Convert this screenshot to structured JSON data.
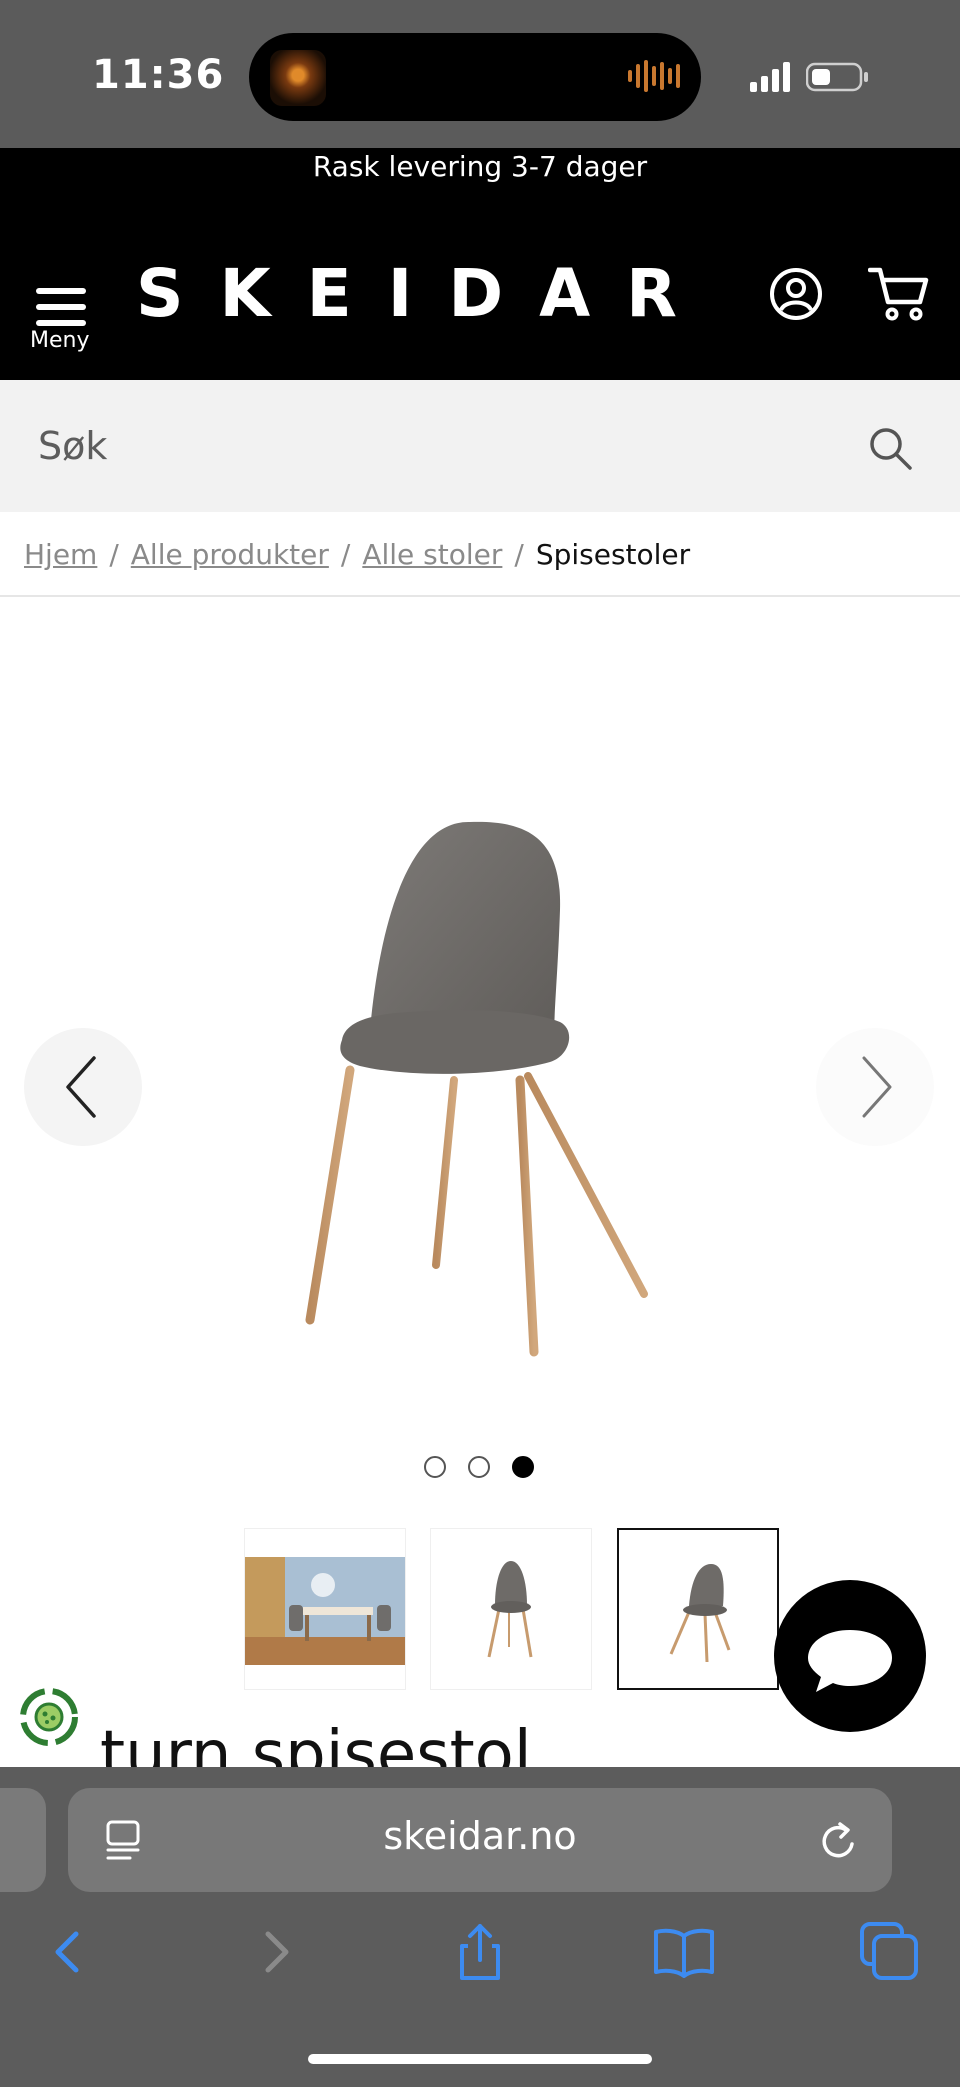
{
  "status_bar": {
    "time": "11:36"
  },
  "announcement": "Rask levering 3-7 dager",
  "header": {
    "menu_label": "Meny",
    "logo": "SKEIDAR"
  },
  "search": {
    "placeholder": "Søk"
  },
  "breadcrumb": {
    "items": [
      "Hjem",
      "Alle produkter",
      "Alle stoler"
    ],
    "separator": "/",
    "current": "Spisestoler"
  },
  "gallery": {
    "image_count": 3,
    "active_index": 2
  },
  "product": {
    "title": "turn spisestol"
  },
  "browser": {
    "url": "skeidar.no"
  },
  "colors": {
    "brand_bg": "#000000",
    "status_bar": "#5b5b5b",
    "search_bg": "#f2f2f2",
    "safari_blue": "#3d8bf0",
    "eco_green": "#2e7d32"
  }
}
